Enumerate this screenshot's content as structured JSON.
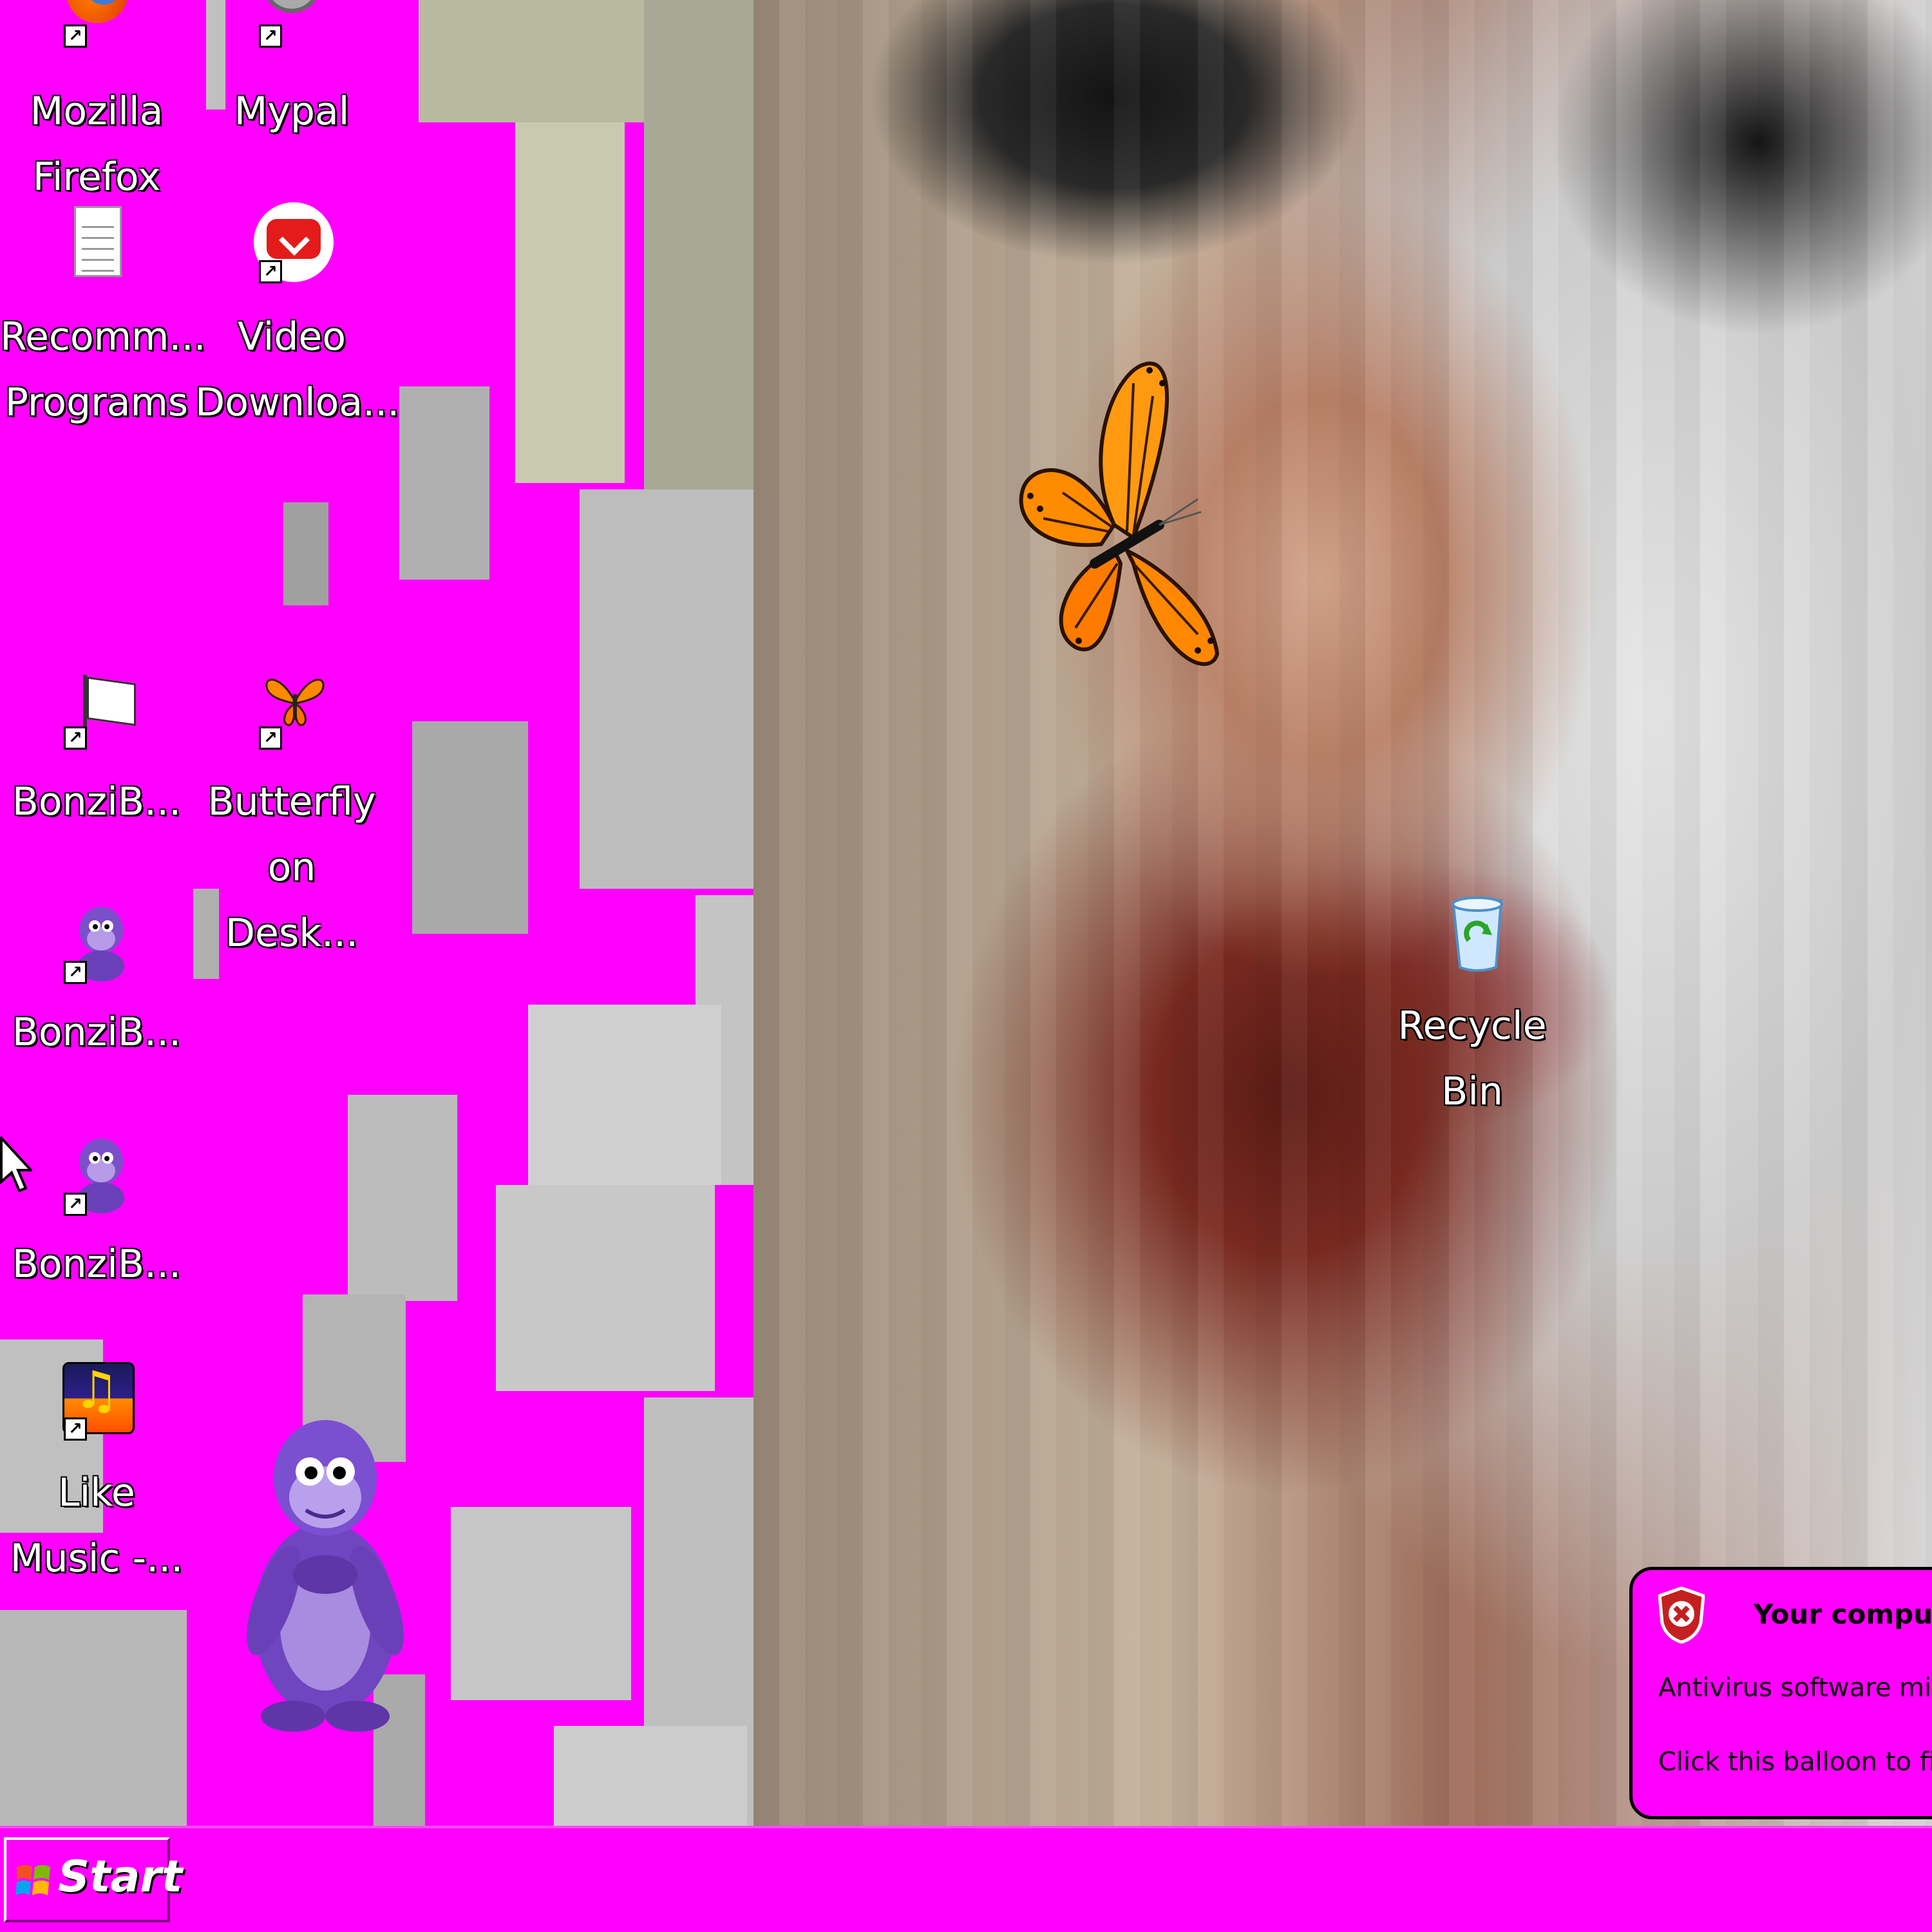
{
  "desktop": {
    "icons": [
      {
        "label": "Mozilla\nFirefox",
        "icon": "firefox-icon"
      },
      {
        "label": "Mypal",
        "icon": "mypal-icon"
      },
      {
        "label": "Recomm...\nPrograms",
        "icon": "notepad-document-icon"
      },
      {
        "label": "Video\nDownloa...",
        "icon": "video-downloader-icon"
      },
      {
        "label": "BonziB...",
        "icon": "flag-icon"
      },
      {
        "label": "Butterfly\non Desk...",
        "icon": "butterfly-icon"
      },
      {
        "label": "BonziB...",
        "icon": "bonzi-icon"
      },
      {
        "label": "BonziB...",
        "icon": "bonzi-icon"
      },
      {
        "label": "Like\nMusic -...",
        "icon": "music-icon"
      },
      {
        "label": "Recycle\nBin",
        "icon": "recycle-bin-icon"
      }
    ]
  },
  "balloon": {
    "title": "Your comput",
    "line1": "Antivirus software migl",
    "line2": "Click this balloon to fix"
  },
  "taskbar": {
    "start_label": "Start"
  },
  "colors": {
    "desktop_background": "#ff00ff",
    "taskbar": "#ff00ff",
    "balloon": "#ff00ff"
  }
}
